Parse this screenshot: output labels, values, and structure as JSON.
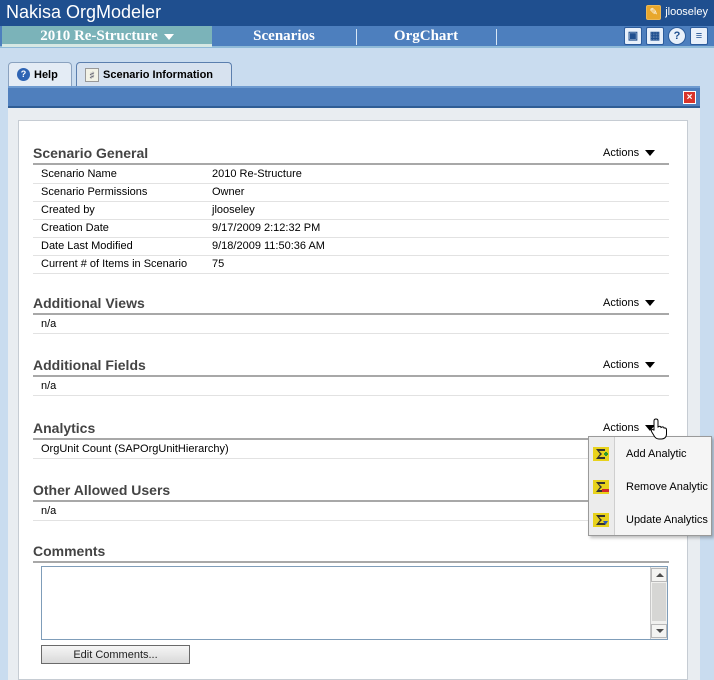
{
  "app": {
    "title": "Nakisa OrgModeler",
    "user": "jlooseley"
  },
  "menu": {
    "scenario_label": "2010 Re-Structure",
    "scenarios_label": "Scenarios",
    "orgchart_label": "OrgChart"
  },
  "tabs": [
    {
      "label": "Help"
    },
    {
      "label": "Scenario Information"
    }
  ],
  "sections": {
    "general": {
      "title": "Scenario General",
      "actions_label": "Actions",
      "rows": [
        {
          "label": "Scenario Name",
          "value": "2010 Re-Structure"
        },
        {
          "label": "Scenario Permissions",
          "value": "Owner"
        },
        {
          "label": "Created by",
          "value": "jlooseley"
        },
        {
          "label": "Creation Date",
          "value": "9/17/2009 2:12:32 PM"
        },
        {
          "label": "Date Last Modified",
          "value": "9/18/2009 11:50:36 AM"
        },
        {
          "label": "Current # of Items in Scenario",
          "value": "75"
        }
      ]
    },
    "views": {
      "title": "Additional Views",
      "actions_label": "Actions",
      "value": "n/a"
    },
    "fields": {
      "title": "Additional Fields",
      "actions_label": "Actions",
      "value": "n/a"
    },
    "analytics": {
      "title": "Analytics",
      "actions_label": "Actions",
      "value": "OrgUnit Count (SAPOrgUnitHierarchy)"
    },
    "users": {
      "title": "Other Allowed Users",
      "value": "n/a"
    },
    "comments": {
      "title": "Comments",
      "text": "",
      "edit_label": "Edit Comments..."
    }
  },
  "analytics_menu": {
    "items": [
      {
        "label": "Add Analytic",
        "icon": "add-analytic-icon"
      },
      {
        "label": "Remove Analytic",
        "icon": "remove-analytic-icon"
      },
      {
        "label": "Update Analytics",
        "icon": "update-analytics-icon"
      }
    ]
  },
  "colors": {
    "header_blue": "#1f4f8f",
    "menu_blue": "#4d7fbe",
    "scenario_teal": "#7bb3b9",
    "close_red": "#d9342b"
  }
}
